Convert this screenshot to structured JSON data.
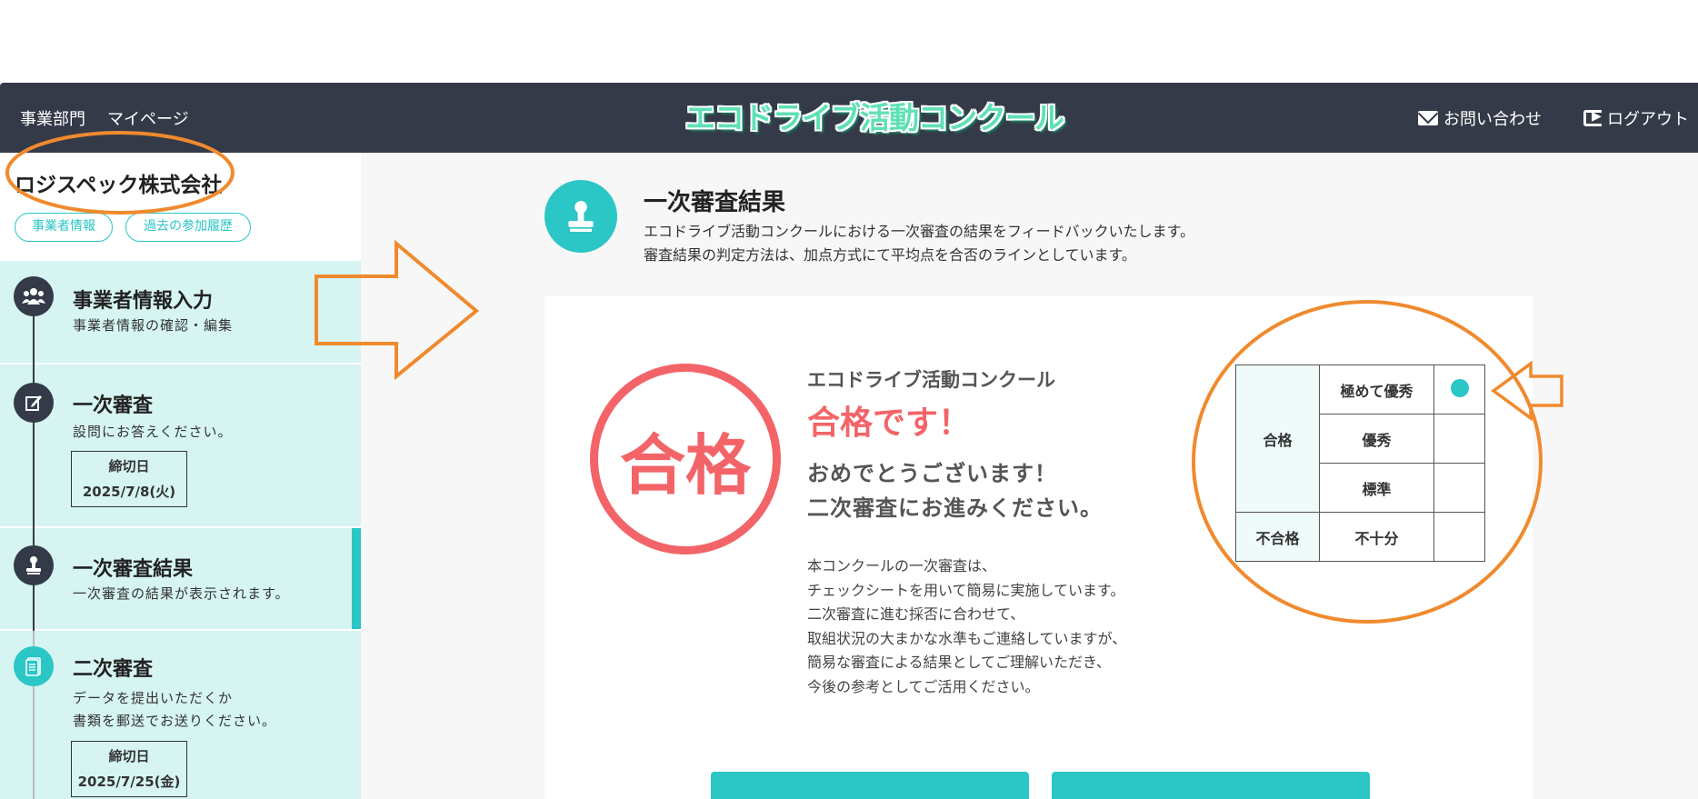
{
  "header": {
    "dept": "事業部門",
    "mypage": "マイページ",
    "logo": "エコドライブ活動コンクール",
    "contact": "お問い合わせ",
    "logout": "ログアウト"
  },
  "sidebar": {
    "company": "ロジスペック株式会社",
    "pills": [
      "事業者情報",
      "過去の参加履歴"
    ],
    "steps": [
      {
        "title": "事業者情報入力",
        "desc": [
          "事業者情報の確認・編集"
        ]
      },
      {
        "title": "一次審査",
        "desc": [
          "設問にお答えください。"
        ],
        "deadline_label": "締切日",
        "deadline": "2025/7/8(火)"
      },
      {
        "title": "一次審査結果",
        "desc": [
          "一次審査の結果が表示されます。"
        ]
      },
      {
        "title": "二次審査",
        "desc": [
          "データを提出いただくか",
          "書類を郵送でお送りください。"
        ],
        "deadline_label": "締切日",
        "deadline": "2025/7/25(金)"
      }
    ]
  },
  "main": {
    "title": "一次審査結果",
    "desc": [
      "エコドライブ活動コンクールにおける一次審査の結果をフィードバックいたします。",
      "審査結果の判定方法は、加点方式にて平均点を合否のラインとしています。"
    ],
    "stamp": "合格",
    "result_heading": "エコドライブ活動コンクール",
    "result_pass": "合格です！",
    "congrats": [
      "おめでとうございます！",
      "二次審査にお進みください。"
    ],
    "body": [
      "本コンクールの一次審査は、",
      "チェックシートを用いて簡易に実施しています。",
      "二次審査に進む採否に合わせて、",
      "取組状況の大まかな水準もご連絡していますが、",
      "簡易な審査による結果としてご理解いただき、",
      "今後の参考としてご活用ください。"
    ],
    "grade_table": {
      "pass_label": "合格",
      "fail_label": "不合格",
      "levels": [
        "極めて優秀",
        "優秀",
        "標準",
        "不十分"
      ],
      "selected": "極めて優秀"
    }
  },
  "colors": {
    "teal": "#2bc6c6",
    "navy": "#343a48",
    "red": "#f36468",
    "annotation": "#f08a2e"
  }
}
